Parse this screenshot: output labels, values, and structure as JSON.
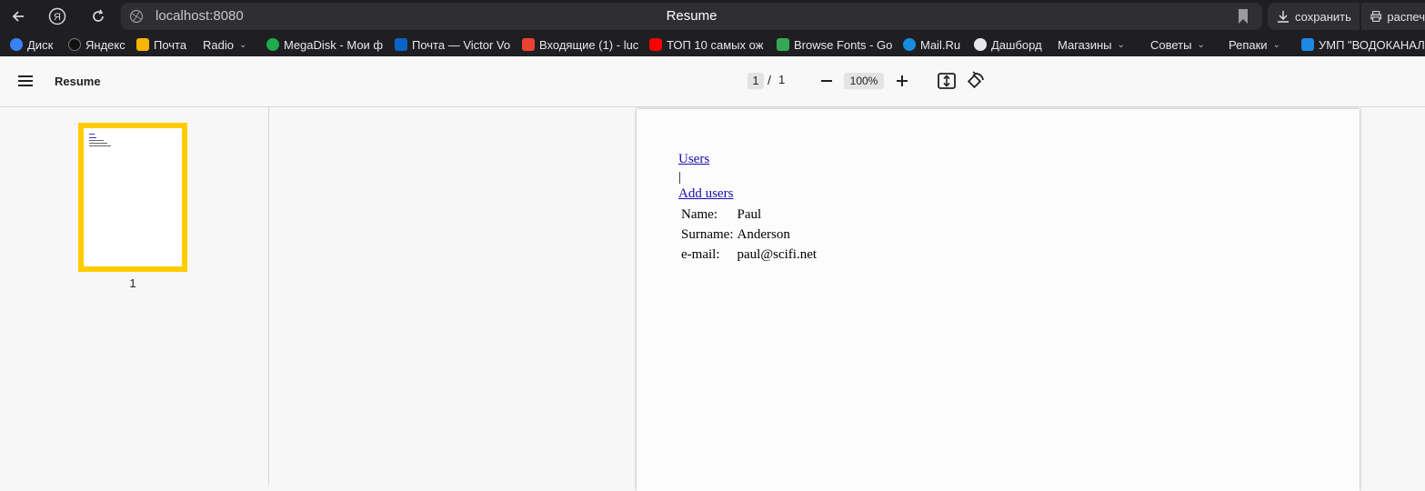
{
  "browser": {
    "url": "localhost:8080",
    "tab_title": "Resume",
    "save_label": "сохранить",
    "print_label": "распеч"
  },
  "bookmarks": [
    {
      "label": "Диск",
      "icon": "yandex-disk-icon",
      "color": "#3b82f6"
    },
    {
      "label": "Яндекс",
      "icon": "yandex-star-icon",
      "color": "#111111"
    },
    {
      "label": "Почта",
      "icon": "mail-envelope-icon",
      "color": "#f5b400"
    },
    {
      "label": "Radio",
      "icon": "",
      "color": "",
      "dropdown": true
    },
    {
      "label": "MegaDisk - Мои ф",
      "icon": "megadisk-icon",
      "color": "#1faa4b"
    },
    {
      "label": "Почта — Victor Vo",
      "icon": "outlook-icon",
      "color": "#0a64c8"
    },
    {
      "label": "Входящие (1) - luc",
      "icon": "gmail-icon",
      "color": "#ea4335"
    },
    {
      "label": "ТОП 10 самых ож",
      "icon": "youtube-icon",
      "color": "#ff0000"
    },
    {
      "label": "Browse Fonts - Go",
      "icon": "google-fonts-icon",
      "color": "#34a853"
    },
    {
      "label": "Mail.Ru",
      "icon": "mailru-icon",
      "color": "#168de2"
    },
    {
      "label": "Дашборд",
      "icon": "cat-icon",
      "color": "#e8e8ea"
    },
    {
      "label": "Магазины",
      "icon": "",
      "color": "",
      "dropdown": true
    },
    {
      "label": "Советы",
      "icon": "",
      "color": "",
      "dropdown": true
    },
    {
      "label": "Репаки",
      "icon": "",
      "color": "",
      "dropdown": true
    },
    {
      "label": "УМП \"ВОДОКАНАЛ",
      "icon": "ump-icon",
      "color": "#1e88e5"
    }
  ],
  "viewer": {
    "doc_title": "Resume",
    "current_page": "1",
    "page_separator": "/",
    "total_pages": "1",
    "zoom": "100%",
    "thumbnail_label": "1"
  },
  "document": {
    "link_users": "Users",
    "separator": "|",
    "link_add_users": "Add users",
    "fields": [
      {
        "label": "Name:",
        "value": "Paul"
      },
      {
        "label": "Surname:",
        "value": "Anderson"
      },
      {
        "label": "e-mail:",
        "value": "paul@scifi.net"
      }
    ]
  }
}
